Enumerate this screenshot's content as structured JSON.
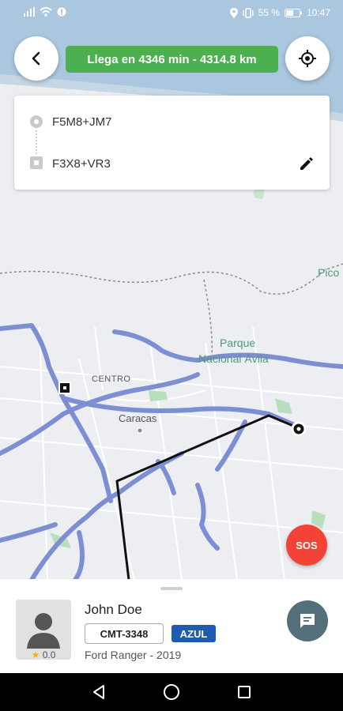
{
  "status_bar": {
    "battery_percent": "55 %",
    "time": "10:47"
  },
  "eta": {
    "text": "Llega en 4346 min - 4314.8 km",
    "color": "#4caf50"
  },
  "route": {
    "origin": "F5M8+JM7",
    "destination": "F3X8+VR3",
    "edit_icon": "pencil-icon"
  },
  "map": {
    "labels": {
      "park": "Parque\nNacional Ávila",
      "park_line1": "Parque",
      "park_line2": "Nacional Ávila",
      "pico": "Pico",
      "centro": "CENTRO",
      "caracas": "Caracas"
    }
  },
  "sos_label": "SOS",
  "driver": {
    "name": "John Doe",
    "rating": "0.0",
    "plate": "CMT-3348",
    "color_label": "AZUL",
    "color_hex": "#1e5bb3",
    "car": "Ford Ranger - 2019"
  },
  "icons": {
    "back": "back-arrow-icon",
    "locate": "gps-locate-icon",
    "chat": "chat-icon",
    "star": "star-icon"
  }
}
